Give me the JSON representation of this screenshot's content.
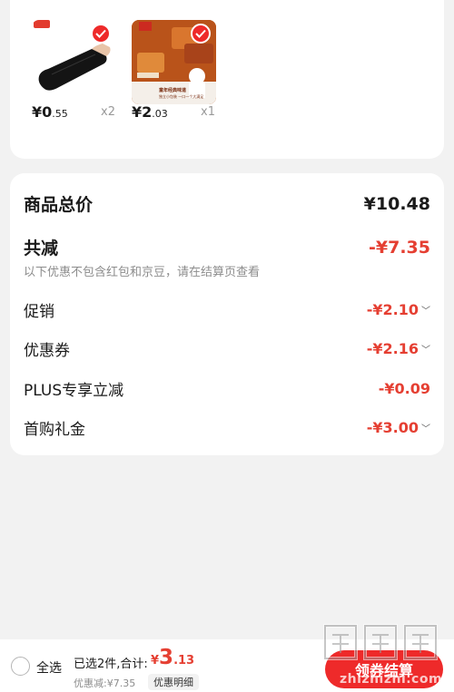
{
  "products": [
    {
      "name": "ice-sleeve",
      "price_int": "¥0",
      "price_dec": ".55",
      "qty": "x2",
      "checked": true
    },
    {
      "name": "dried-meat",
      "price_int": "¥2",
      "price_dec": ".03",
      "qty": "x1",
      "checked": true,
      "promo_text": "童年经典味道",
      "promo_sub": "独立小包装  一口一个大满足"
    }
  ],
  "summary": {
    "total_label": "商品总价",
    "total_value": "¥10.48",
    "reduce_label": "共减",
    "reduce_value": "-¥7.35",
    "note": "以下优惠不包含红包和京豆，请在结算页查看",
    "items": [
      {
        "label": "促销",
        "value": "-¥2.10",
        "expandable": true
      },
      {
        "label": "优惠券",
        "value": "-¥2.16",
        "expandable": true
      },
      {
        "label": "PLUS专享立减",
        "value": "-¥0.09",
        "expandable": false
      },
      {
        "label": "首购礼金",
        "value": "-¥3.00",
        "expandable": true
      }
    ]
  },
  "bottom": {
    "select_all": "全选",
    "selected_info": "已选2件,合计:",
    "total_currency": "¥",
    "total_int": "3",
    "total_dec": ".13",
    "discount_text": "优惠减:¥7.35",
    "detail_button": "优惠明细",
    "checkout_button": "领券结算"
  },
  "watermark": {
    "text": "zhizhizhi.com"
  },
  "colors": {
    "accent": "#ee2a2a",
    "price_red": "#e53f32",
    "background": "#f2f2f2"
  }
}
